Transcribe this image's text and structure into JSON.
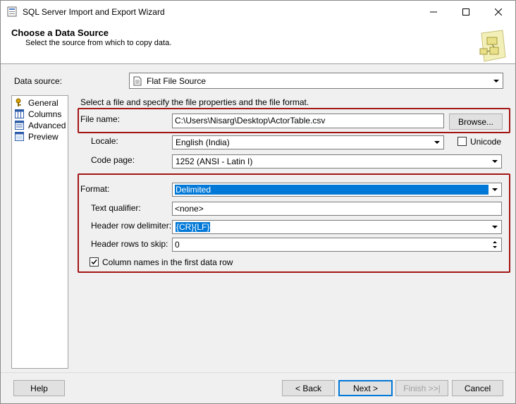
{
  "window": {
    "title": "SQL Server Import and Export Wizard",
    "minimize_icon": "minimize-icon",
    "maximize_icon": "maximize-icon",
    "close_icon": "close-icon"
  },
  "header": {
    "title": "Choose a Data Source",
    "subtitle": "Select the source from which to copy data."
  },
  "data_source": {
    "label": "Data source:",
    "value": "Flat File Source"
  },
  "nav": {
    "items": [
      {
        "label": "General",
        "icon": "general-icon"
      },
      {
        "label": "Columns",
        "icon": "columns-icon"
      },
      {
        "label": "Advanced",
        "icon": "advanced-icon"
      },
      {
        "label": "Preview",
        "icon": "preview-icon"
      }
    ]
  },
  "general": {
    "instruction": "Select a file and specify the file properties and the file format.",
    "file_name_label": "File name:",
    "file_name_value": "C:\\Users\\Nisarg\\Desktop\\ActorTable.csv",
    "browse_label": "Browse...",
    "locale_label": "Locale:",
    "locale_value": "English (India)",
    "unicode_label": "Unicode",
    "unicode_checked": false,
    "code_page_label": "Code page:",
    "code_page_value": "1252  (ANSI - Latin I)",
    "format_label": "Format:",
    "format_value": "Delimited",
    "text_qualifier_label": "Text qualifier:",
    "text_qualifier_value": "<none>",
    "header_row_delimiter_label": "Header row delimiter:",
    "header_row_delimiter_value": "{CR}{LF}",
    "header_rows_to_skip_label": "Header rows to skip:",
    "header_rows_to_skip_value": "0",
    "column_names_label": "Column names in the first data row",
    "column_names_checked": true
  },
  "footer": {
    "help": "Help",
    "back": "< Back",
    "next": "Next >",
    "finish": "Finish >>|",
    "cancel": "Cancel"
  },
  "colors": {
    "highlight_frame": "#a31515",
    "selection": "#0078d7"
  }
}
